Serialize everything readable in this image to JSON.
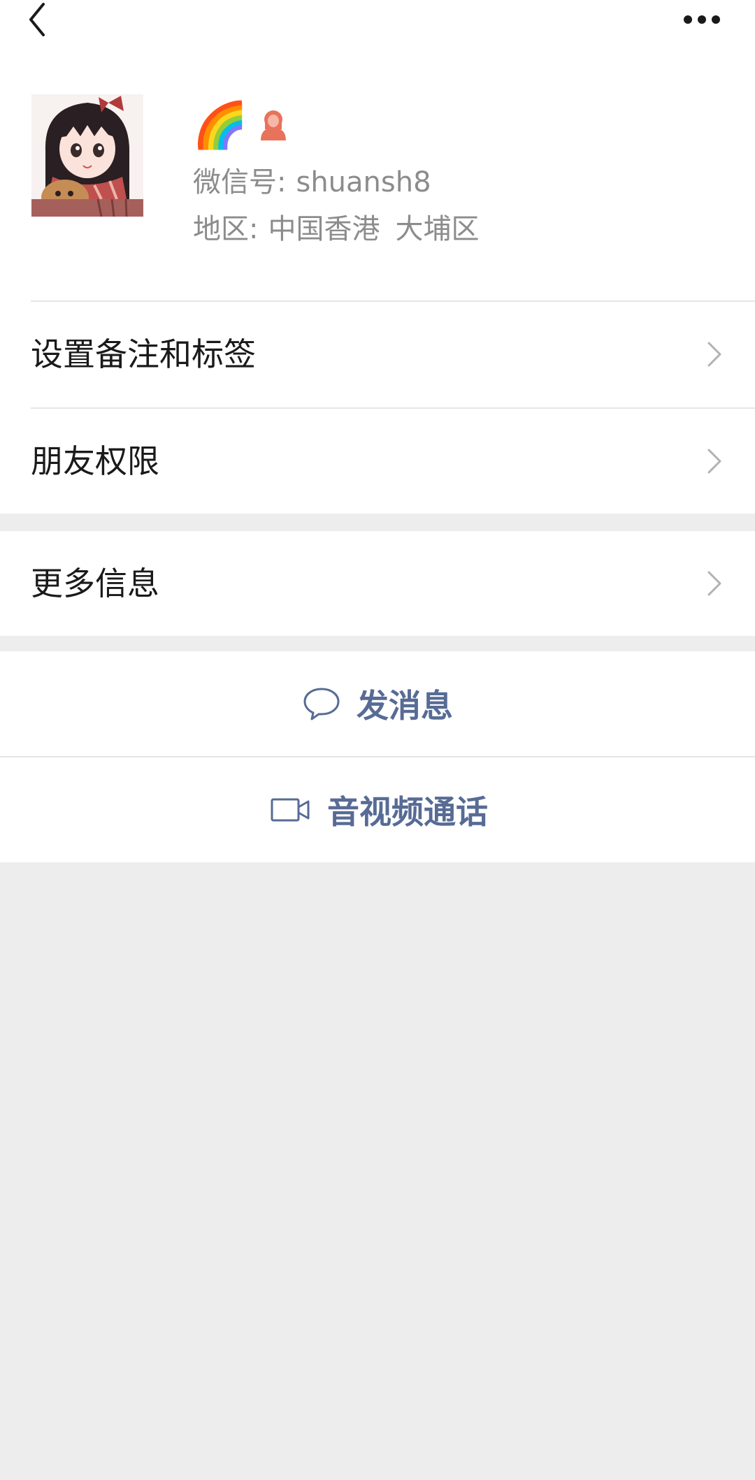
{
  "profile": {
    "nickname_emoji": "🌈",
    "wechat_id_label": "微信号:",
    "wechat_id_value": "shuansh8",
    "region_label": "地区:",
    "region_country": "中国香港",
    "region_district": "大埔区",
    "gender_icon": "female-icon"
  },
  "menu": {
    "items": [
      {
        "label": "设置备注和标签"
      },
      {
        "label": "朋友权限"
      },
      {
        "label": "更多信息"
      }
    ]
  },
  "actions": {
    "send_message": "发消息",
    "av_call": "音视频通话"
  },
  "colors": {
    "link_blue": "#576b95",
    "background_gray": "#ededed",
    "female_icon": "#e8735a"
  }
}
